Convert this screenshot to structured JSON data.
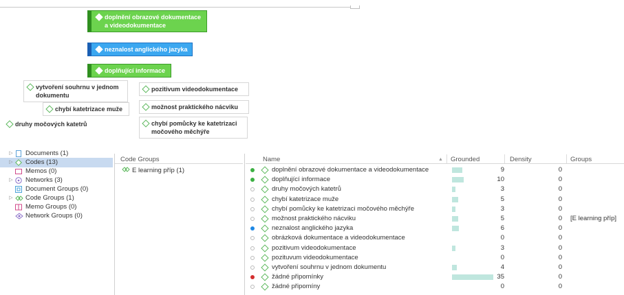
{
  "network": {
    "nodes": [
      {
        "id": "n1",
        "style": "green",
        "label": "doplnění obrazové dokumentace\na videodokumentace"
      },
      {
        "id": "n2",
        "style": "blue",
        "label": "neznalost anglického jazyka"
      },
      {
        "id": "n3",
        "style": "green",
        "label": "doplňující informace"
      },
      {
        "id": "n4",
        "style": "white",
        "label": "vytvoření souhrnu v jednom\ndokumentu"
      },
      {
        "id": "n5",
        "style": "white",
        "label": "pozitivum videodokumentace"
      },
      {
        "id": "n6",
        "style": "white",
        "label": "chybí katetrizace muže"
      },
      {
        "id": "n7",
        "style": "white",
        "label": "možnost praktického nácviku"
      },
      {
        "id": "n8",
        "style": "plain",
        "label": "druhy močových katetrů"
      },
      {
        "id": "n9",
        "style": "white",
        "label": "chybí pomůcky ke katetrizaci\nmočového měchýře"
      }
    ]
  },
  "tree": {
    "items": [
      {
        "label": "Documents (1)",
        "icon": "document-icon",
        "color": "#5aa0d8",
        "arrow": "▷",
        "selected": false
      },
      {
        "label": "Codes (13)",
        "icon": "code-diamond-icon",
        "color": "#5cb85c",
        "arrow": "▷",
        "selected": true
      },
      {
        "label": "Memos (0)",
        "icon": "memo-icon",
        "color": "#d04a8a",
        "arrow": "",
        "selected": false
      },
      {
        "label": "Networks (3)",
        "icon": "network-icon",
        "color": "#8a6fc9",
        "arrow": "▷",
        "selected": false
      },
      {
        "label": "Document Groups (0)",
        "icon": "document-group-icon",
        "color": "#4aa3d8",
        "arrow": "",
        "selected": false
      },
      {
        "label": "Code Groups (1)",
        "icon": "code-group-icon",
        "color": "#5cb85c",
        "arrow": "▷",
        "selected": false
      },
      {
        "label": "Memo Groups (0)",
        "icon": "memo-group-icon",
        "color": "#d04a8a",
        "arrow": "",
        "selected": false
      },
      {
        "label": "Network Groups (0)",
        "icon": "network-group-icon",
        "color": "#8a6fc9",
        "arrow": "",
        "selected": false
      }
    ]
  },
  "code_groups": {
    "header": "Code Groups",
    "items": [
      {
        "label": "E learning příp (1)",
        "icon": "code-group-icon"
      }
    ]
  },
  "codes_table": {
    "headers": {
      "name": "Name",
      "grounded": "Grounded",
      "density": "Density",
      "groups": "Groups",
      "sort_icon": "▲"
    },
    "max_grounded": 35,
    "rows": [
      {
        "dot": "#3cb043",
        "name": "doplnění obrazové dokumentace a videodokumentace",
        "grounded": 9,
        "density": 0,
        "groups": ""
      },
      {
        "dot": "#3cb043",
        "name": "doplňující informace",
        "grounded": 10,
        "density": 0,
        "groups": ""
      },
      {
        "dot": "",
        "name": "druhy močových katetrů",
        "grounded": 3,
        "density": 0,
        "groups": ""
      },
      {
        "dot": "",
        "name": "chybí katetrizace muže",
        "grounded": 5,
        "density": 0,
        "groups": ""
      },
      {
        "dot": "",
        "name": "chybí pomůcky ke katetrizaci močového měchýře",
        "grounded": 3,
        "density": 0,
        "groups": ""
      },
      {
        "dot": "",
        "name": "možnost praktického nácviku",
        "grounded": 5,
        "density": 0,
        "groups": "[E learning příp]"
      },
      {
        "dot": "#1e88e5",
        "name": "neznalost anglického jazyka",
        "grounded": 6,
        "density": 0,
        "groups": ""
      },
      {
        "dot": "",
        "name": "obrázková dokumentace a videodokumentace",
        "grounded": 0,
        "density": 0,
        "groups": ""
      },
      {
        "dot": "",
        "name": "pozitivum videodokumentace",
        "grounded": 3,
        "density": 0,
        "groups": ""
      },
      {
        "dot": "",
        "name": "pozituvum videodokumentace",
        "grounded": 0,
        "density": 0,
        "groups": ""
      },
      {
        "dot": "",
        "name": "vytvoření souhrnu v jednom dokumentu",
        "grounded": 4,
        "density": 0,
        "groups": ""
      },
      {
        "dot": "#d32f2f",
        "name": "žádné připomínky",
        "grounded": 35,
        "density": 0,
        "groups": ""
      },
      {
        "dot": "",
        "name": "žádné připomíny",
        "grounded": 0,
        "density": 0,
        "groups": ""
      }
    ]
  }
}
